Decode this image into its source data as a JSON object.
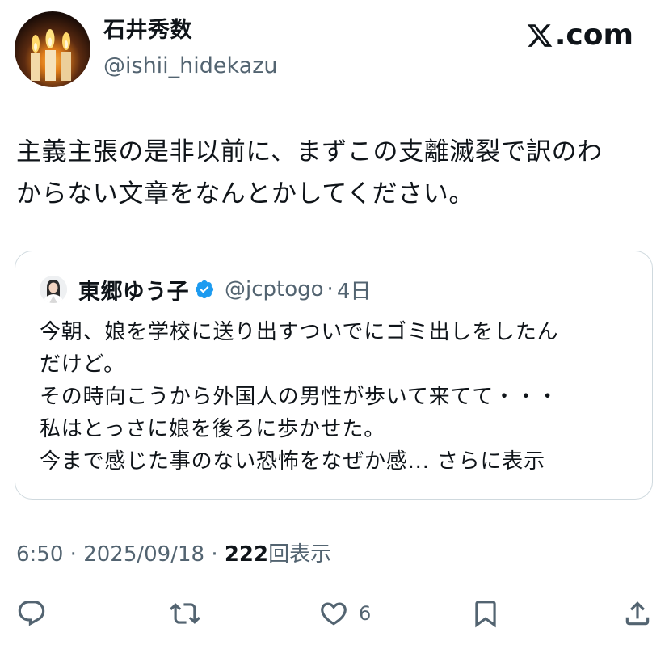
{
  "header": {
    "display_name": "石井秀数",
    "handle": "@ishii_hidekazu",
    "site_label": ".com",
    "site_logo_icon": "x-logo-icon"
  },
  "tweet": {
    "text_line1": "主義主張の是非以前に、まずこの支離滅裂で訳のわ",
    "text_line2": "からない文章をなんとかしてください。"
  },
  "quote": {
    "name": "東郷ゆう子",
    "verified_icon": "verified-badge-icon",
    "handle": "@jcptogo",
    "separator": "·",
    "time": "4日",
    "lines": [
      "今朝、娘を学校に送り出すついでにゴミ出しをしたん",
      "だけど。",
      "その時向こうから外国人の男性が歩いて来てて・・・",
      "私はとっさに娘を後ろに歩かせた。"
    ],
    "last_line": "今まで感じた事のない恐怖をなぜか感...",
    "show_more": "さらに表示"
  },
  "meta": {
    "time": "6:50",
    "sep1": "·",
    "date": "2025/09/18",
    "sep2": "·",
    "views": "222",
    "views_label": "回表示"
  },
  "actions": {
    "reply_icon": "reply-icon",
    "repost_icon": "repost-icon",
    "like_icon": "heart-icon",
    "like_count": "6",
    "bookmark_icon": "bookmark-icon",
    "share_icon": "share-icon"
  },
  "colors": {
    "text": "#0f1419",
    "secondary": "#536471",
    "border": "#cfd9de",
    "verified": "#1d9bf0"
  }
}
